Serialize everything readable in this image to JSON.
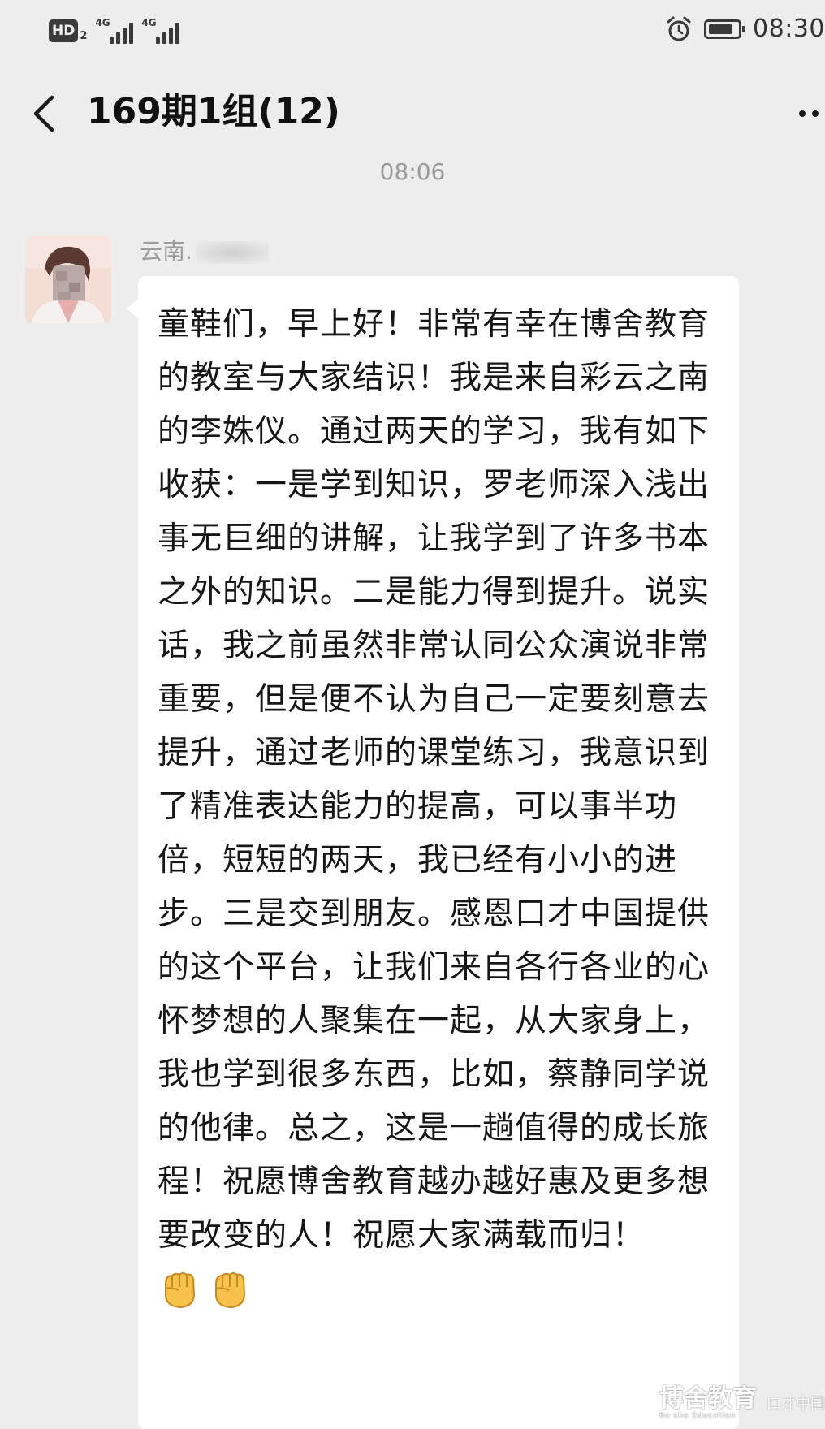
{
  "status_bar": {
    "hd_label": "HD",
    "hd_sub": "2",
    "sim1_net": "4G",
    "sim2_net": "4G",
    "battery_level": 0.85,
    "time": "08:30"
  },
  "nav": {
    "title": "169期1组(12)"
  },
  "chat": {
    "time_separator": "08:06",
    "sender_name_visible": "云南.",
    "message": "童鞋们，早上好！非常有幸在博舍教育的教室与大家结识！我是来自彩云之南的李姝仪。通过两天的学习，我有如下收获：一是学到知识，罗老师深入浅出事无巨细的讲解，让我学到了许多书本之外的知识。二是能力得到提升。说实话，我之前虽然非常认同公众演说非常重要，但是便不认为自己一定要刻意去提升，通过老师的课堂练习，我意识到了精准表达能力的提高，可以事半功倍，短短的两天，我已经有小小的进步。三是交到朋友。感恩口才中国提供的这个平台，让我们来自各行各业的心怀梦想的人聚集在一起，从大家身上，我也学到很多东西，比如，蔡静同学说的他律。总之，这是一趟值得的成长旅程！祝愿博舍教育越办越好惠及更多想要改变的人！祝愿大家满载而归！",
    "emoji": [
      "fist-icon",
      "fist-icon"
    ]
  },
  "watermark": {
    "main": "博舍教育",
    "sub": "Bo she Education",
    "side": "口才中国"
  }
}
